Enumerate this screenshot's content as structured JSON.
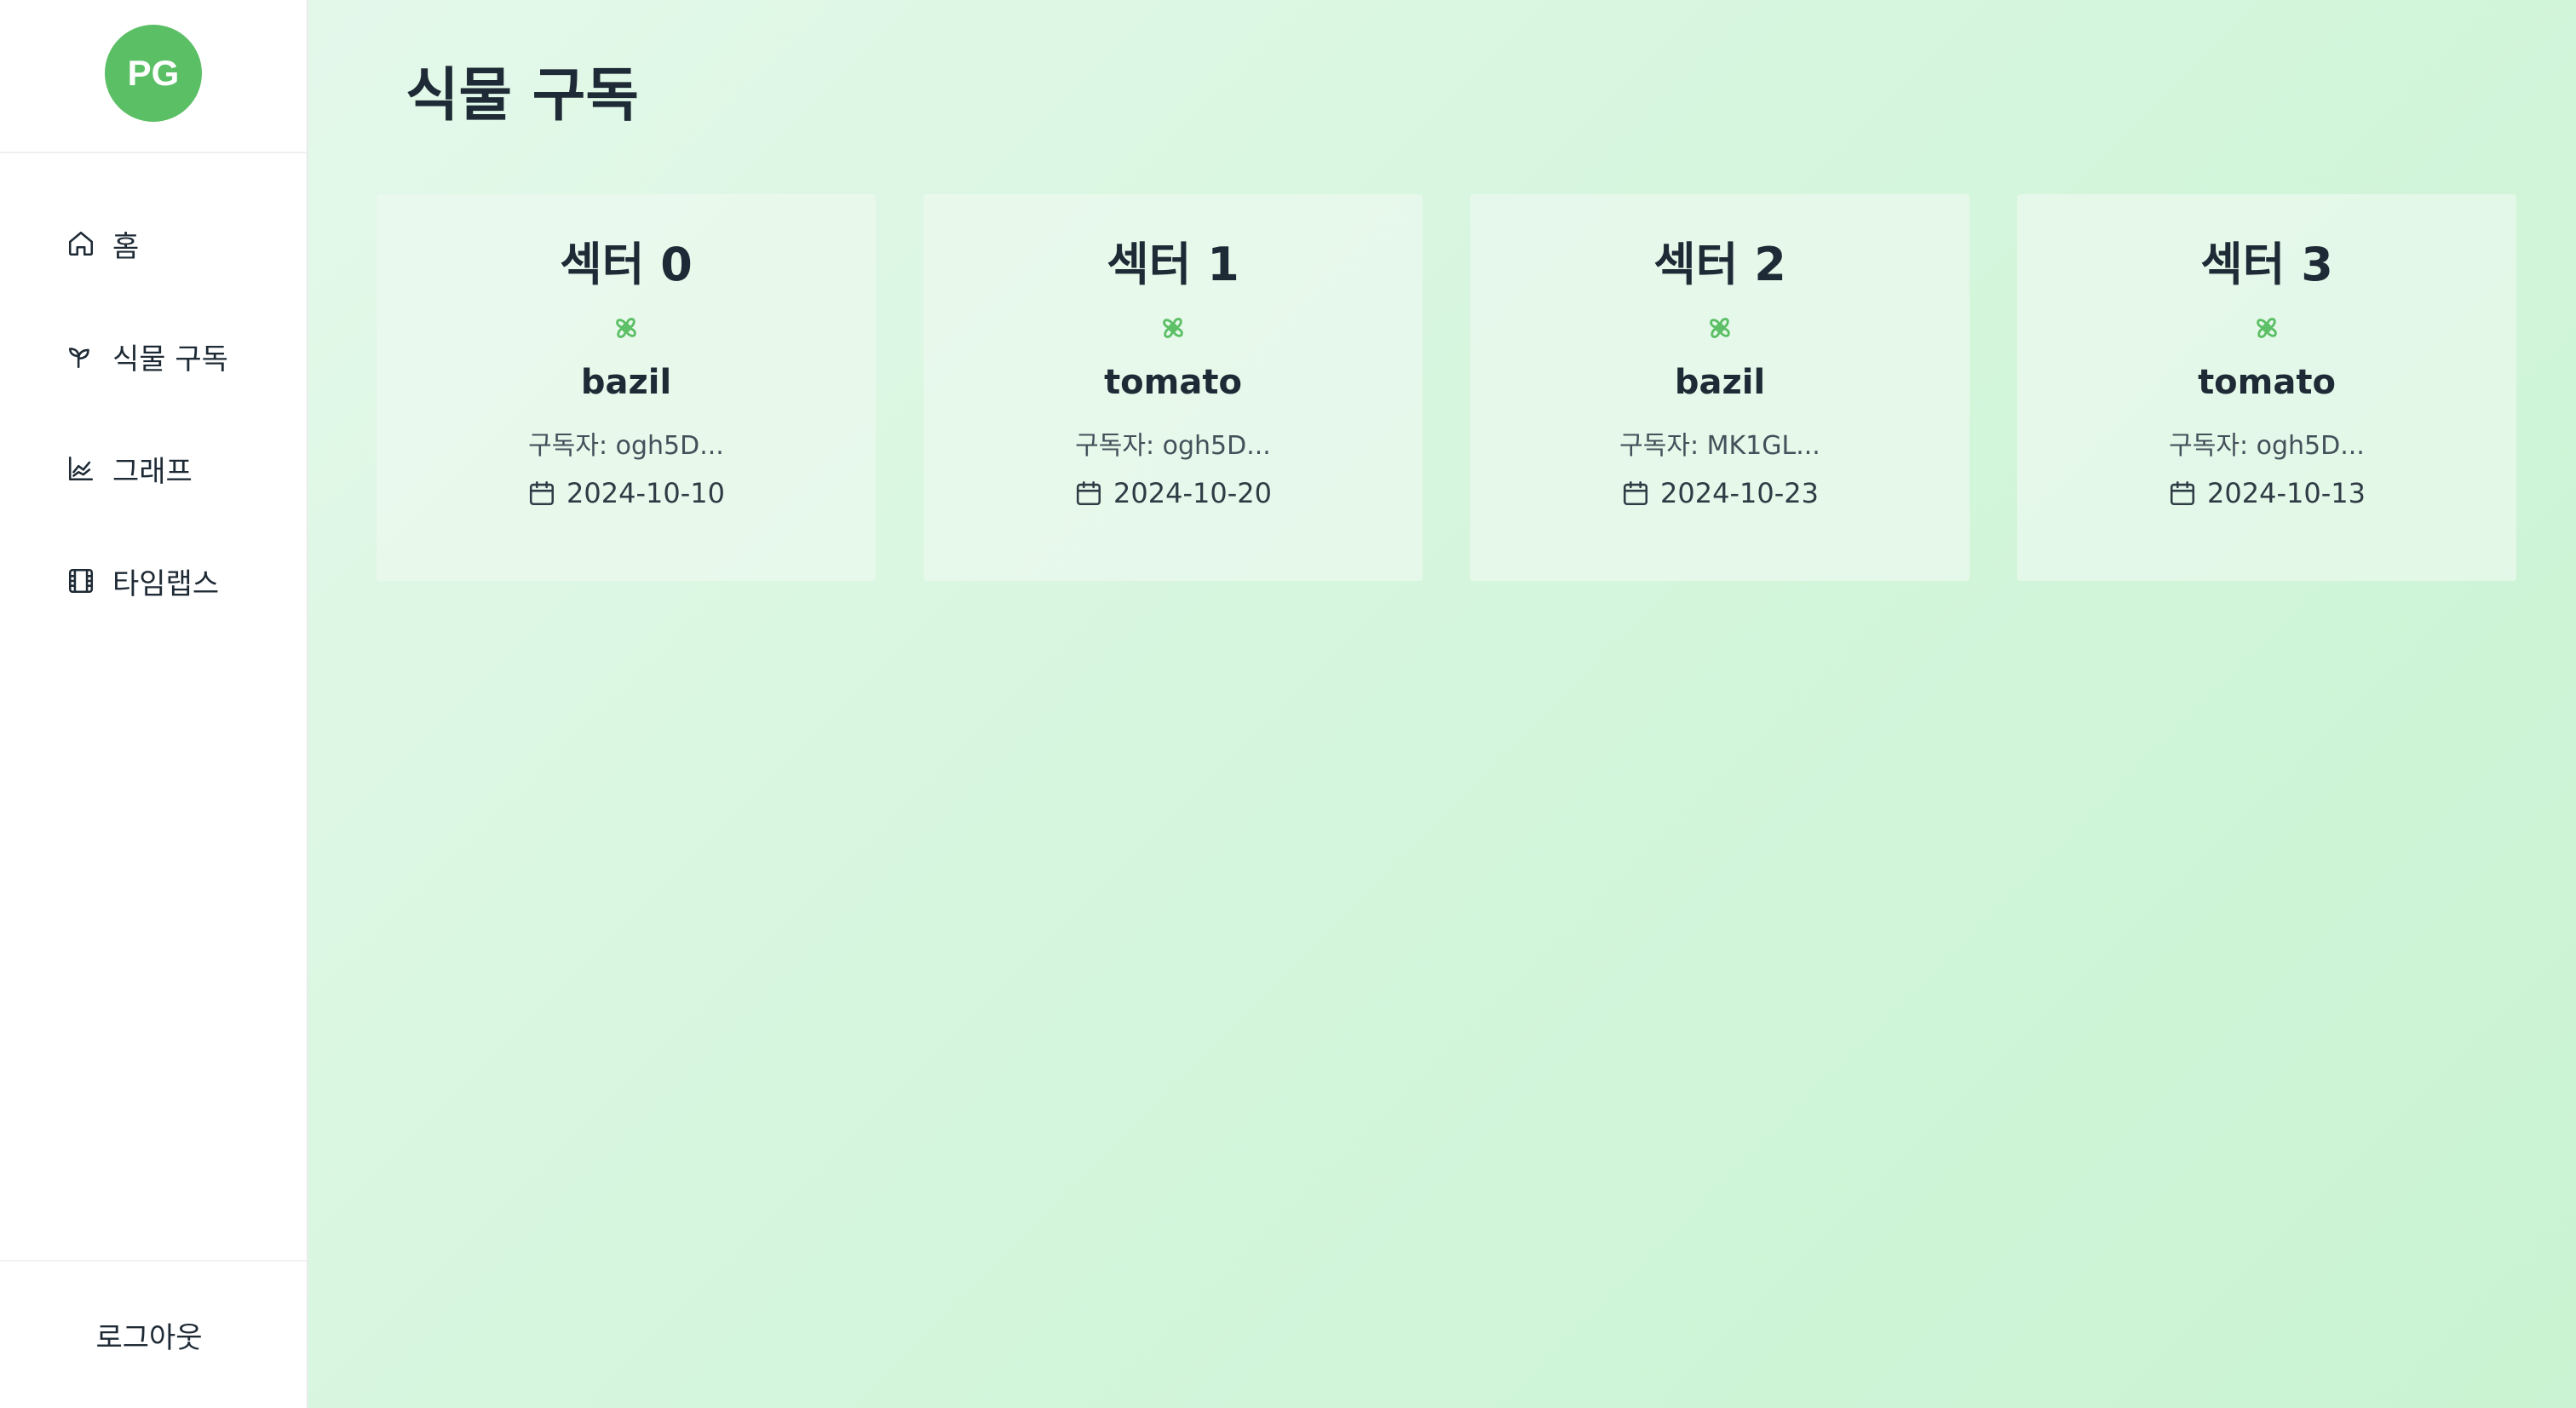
{
  "sidebar": {
    "avatar_text": "PG",
    "items": [
      {
        "label": "홈",
        "icon": "home-icon"
      },
      {
        "label": "식물 구독",
        "icon": "sprout-icon"
      },
      {
        "label": "그래프",
        "icon": "chart-icon"
      },
      {
        "label": "타임랩스",
        "icon": "film-icon"
      }
    ],
    "logout_label": "로그아웃"
  },
  "main": {
    "title": "식물 구독",
    "cards": [
      {
        "title": "섹터 0",
        "plant": "bazil",
        "subscriber": "구독자: ogh5D...",
        "date": "2024-10-10"
      },
      {
        "title": "섹터 1",
        "plant": "tomato",
        "subscriber": "구독자: ogh5D...",
        "date": "2024-10-20"
      },
      {
        "title": "섹터 2",
        "plant": "bazil",
        "subscriber": "구독자: MK1GL...",
        "date": "2024-10-23"
      },
      {
        "title": "섹터 3",
        "plant": "tomato",
        "subscriber": "구독자: ogh5D...",
        "date": "2024-10-13"
      }
    ]
  },
  "colors": {
    "accent": "#5bbf65",
    "flower_icon": "#5bbf65",
    "text": "#1e2a35",
    "background_start": "#e4f8ea",
    "background_end": "#c9f3d2"
  }
}
